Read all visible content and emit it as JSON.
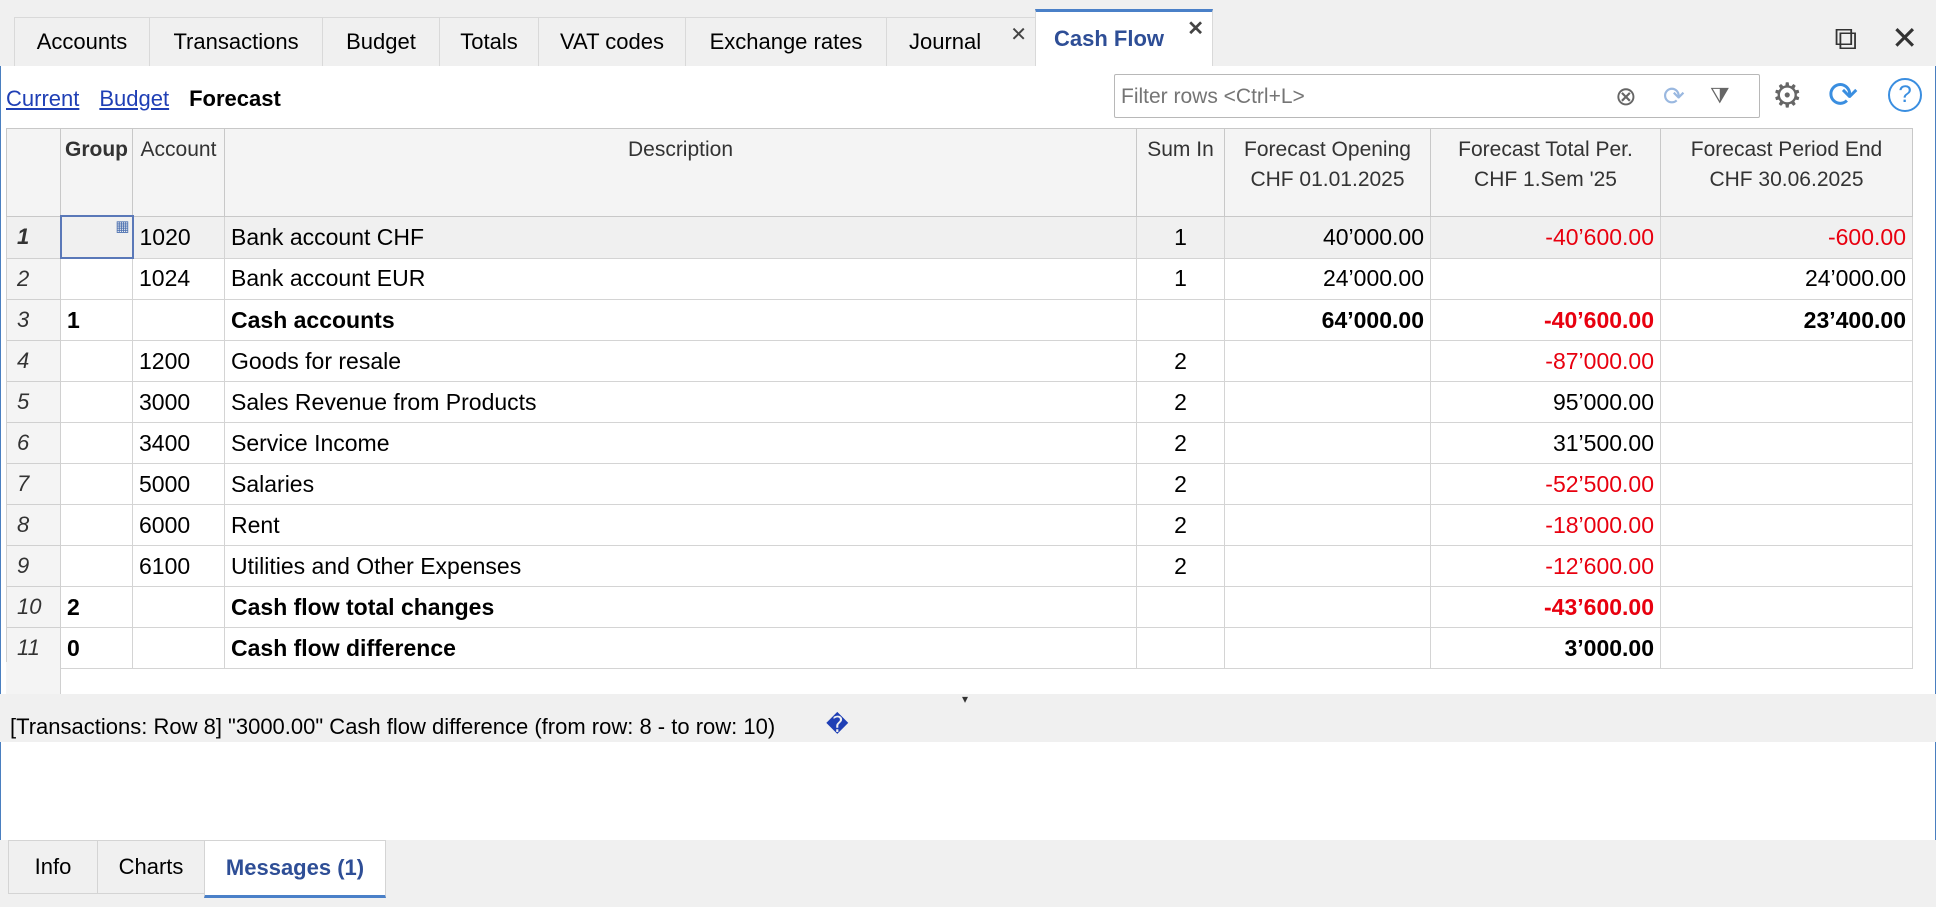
{
  "tabs": [
    {
      "label": "Accounts"
    },
    {
      "label": "Transactions"
    },
    {
      "label": "Budget"
    },
    {
      "label": "Totals"
    },
    {
      "label": "VAT codes"
    },
    {
      "label": "Exchange rates"
    },
    {
      "label": "Journal",
      "close": "✕"
    },
    {
      "label": "Cash Flow",
      "close": "✕"
    }
  ],
  "subnav": {
    "current": "Current",
    "budget": "Budget",
    "forecast": "Forecast"
  },
  "filter": {
    "placeholder": "Filter rows <Ctrl+L>"
  },
  "columns": {
    "group": "Group",
    "account": "Account",
    "description": "Description",
    "sumin": "Sum In",
    "opening_1": "Forecast Opening",
    "opening_2": "CHF 01.01.2025",
    "total_1": "Forecast Total Per.",
    "total_2": "CHF 1.Sem '25",
    "end_1": "Forecast Period End",
    "end_2": "CHF 30.06.2025"
  },
  "rows": [
    {
      "n": "1",
      "group": "",
      "account": "1020",
      "desc": "Bank account CHF",
      "sumin": "1",
      "opening": "40’000.00",
      "total": "-40’600.00",
      "end": "-600.00"
    },
    {
      "n": "2",
      "group": "",
      "account": "1024",
      "desc": "Bank account EUR",
      "sumin": "1",
      "opening": "24’000.00",
      "total": "",
      "end": "24’000.00"
    },
    {
      "n": "3",
      "group": "1",
      "account": "",
      "desc": "Cash accounts",
      "sumin": "",
      "opening": "64’000.00",
      "total": "-40’600.00",
      "end": "23’400.00"
    },
    {
      "n": "4",
      "group": "",
      "account": "1200",
      "desc": "Goods for resale",
      "sumin": "2",
      "opening": "",
      "total": "-87’000.00",
      "end": ""
    },
    {
      "n": "5",
      "group": "",
      "account": "3000",
      "desc": "Sales Revenue from Products",
      "sumin": "2",
      "opening": "",
      "total": "95’000.00",
      "end": ""
    },
    {
      "n": "6",
      "group": "",
      "account": "3400",
      "desc": "Service Income",
      "sumin": "2",
      "opening": "",
      "total": "31’500.00",
      "end": ""
    },
    {
      "n": "7",
      "group": "",
      "account": "5000",
      "desc": "Salaries",
      "sumin": "2",
      "opening": "",
      "total": "-52’500.00",
      "end": ""
    },
    {
      "n": "8",
      "group": "",
      "account": "6000",
      "desc": "Rent",
      "sumin": "2",
      "opening": "",
      "total": "-18’000.00",
      "end": ""
    },
    {
      "n": "9",
      "group": "",
      "account": "6100",
      "desc": "Utilities and Other Expenses",
      "sumin": "2",
      "opening": "",
      "total": "-12’600.00",
      "end": ""
    },
    {
      "n": "10",
      "group": "2",
      "account": "",
      "desc": "Cash flow total changes",
      "sumin": "",
      "opening": "",
      "total": "-43’600.00",
      "end": ""
    },
    {
      "n": "11",
      "group": "0",
      "account": "",
      "desc": "Cash flow difference",
      "sumin": "",
      "opening": "",
      "total": "3’000.00",
      "end": ""
    }
  ],
  "message": {
    "text": "[Transactions: Row 8] \"3000.00\" Cash flow difference (from row: 8 - to row: 10)",
    "glyph": "�"
  },
  "bottom_tabs": [
    {
      "label": "Info"
    },
    {
      "label": "Charts"
    },
    {
      "label": "Messages (1)"
    }
  ],
  "icons": {
    "clear": "clear-filter-icon",
    "refresh": "refresh-icon",
    "sort_filter": "filter-sort-icon",
    "settings": "gear-icon",
    "sync": "recalculate-icon",
    "help": "help-icon",
    "restore": "restore-window-icon",
    "close": "close-window-icon"
  },
  "colors": {
    "negative": "#e8000f",
    "accent": "#2e4e96",
    "link": "#1f3fb5"
  }
}
